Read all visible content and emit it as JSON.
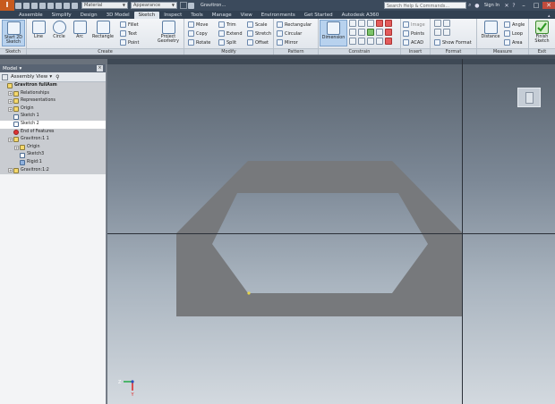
{
  "titlebar": {
    "logo": "I",
    "material": "Material",
    "appearance": "Appearance",
    "doc_title": "Gravitron...",
    "search_placeholder": "Search Help & Commands...",
    "sign_in": "Sign In",
    "win_min": "–",
    "win_max": "□",
    "win_close": "✕"
  },
  "tabs": [
    "Assemble",
    "Simplify",
    "Design",
    "3D Model",
    "Sketch",
    "Inspect",
    "Tools",
    "Manage",
    "View",
    "Environments",
    "Get Started",
    "Autodesk A360"
  ],
  "active_tab": "Sketch",
  "ribbon": {
    "sketch": {
      "title": "Sketch",
      "start": "Start 2D Sketch"
    },
    "create": {
      "title": "Create",
      "line": "Line",
      "circle": "Circle",
      "arc": "Arc",
      "rectangle": "Rectangle",
      "fillet": "Fillet",
      "text": "Text",
      "point": "Point",
      "project": "Project Geometry"
    },
    "modify": {
      "title": "Modify",
      "move": "Move",
      "copy": "Copy",
      "rotate": "Rotate",
      "trim": "Trim",
      "extend": "Extend",
      "split": "Split",
      "scale": "Scale",
      "stretch": "Stretch",
      "offset": "Offset"
    },
    "pattern": {
      "title": "Pattern",
      "rectangular": "Rectangular",
      "circular": "Circular",
      "mirror": "Mirror"
    },
    "constrain": {
      "title": "Constrain",
      "dimension": "Dimension"
    },
    "insert": {
      "title": "Insert",
      "image": "Image",
      "points": "Points",
      "acad": "ACAD"
    },
    "format": {
      "title": "Format",
      "show_format": "Show Format"
    },
    "measure": {
      "title": "Measure",
      "distance": "Distance",
      "angle": "Angle",
      "loop": "Loop",
      "area": "Area"
    },
    "exit": {
      "title": "Exit",
      "finish": "Finish Sketch"
    }
  },
  "browser": {
    "title": "Model",
    "view": "Assembly View",
    "items": [
      {
        "label": "Gravitron fullAsm",
        "depth": 0,
        "icon": "assembly",
        "style": "shaded bold"
      },
      {
        "label": "Relationships",
        "depth": 1,
        "icon": "folder",
        "style": "shaded"
      },
      {
        "label": "Representations",
        "depth": 1,
        "icon": "folder",
        "style": "shaded"
      },
      {
        "label": "Origin",
        "depth": 1,
        "icon": "folder",
        "style": "shaded"
      },
      {
        "label": "Sketch 1",
        "depth": 1,
        "icon": "sketch",
        "style": "shaded"
      },
      {
        "label": "Sketch 2",
        "depth": 1,
        "icon": "sketch",
        "style": "sel"
      },
      {
        "label": "End of Features",
        "depth": 1,
        "icon": "eof",
        "style": "shaded"
      },
      {
        "label": "Gravitron:1 1",
        "depth": 1,
        "icon": "part",
        "style": "shaded"
      },
      {
        "label": "Origin",
        "depth": 2,
        "icon": "folder",
        "style": "shaded"
      },
      {
        "label": "Sketch3",
        "depth": 2,
        "icon": "sketch",
        "style": "shaded"
      },
      {
        "label": "Rigid:1",
        "depth": 2,
        "icon": "blue",
        "style": "shaded"
      },
      {
        "label": "Gravitron:1:2",
        "depth": 1,
        "icon": "part",
        "style": "shaded"
      }
    ]
  },
  "viewport": {
    "axis_z": "Z",
    "axis_y": "Y",
    "shape_color": "#77797c",
    "bg_color": "#8e99a6"
  }
}
